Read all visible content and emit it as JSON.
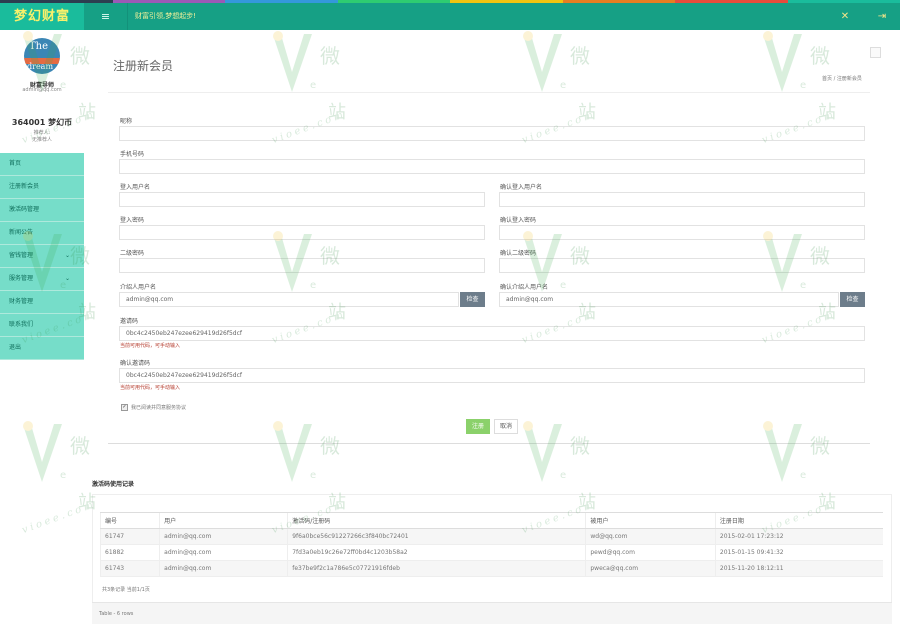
{
  "header": {
    "brand": "梦幻财富",
    "menu_icon": "≡",
    "menu_icon_name": "menu-icon",
    "marquee": "财富引领,梦想起步!",
    "tool_icon": "✕",
    "exit_icon": "⇥",
    "colors": {
      "bar": "#16a085",
      "brand_bg": "#1abc9c",
      "brand_text": "#f9f06b"
    },
    "rainbow": [
      "#2c3e50",
      "#9b59b6",
      "#3498db",
      "#2ecc71",
      "#f1c40f",
      "#e67e22",
      "#e74c3c",
      "#1abc9c"
    ]
  },
  "sidebar": {
    "avatar_text_top": "The",
    "avatar_text_bottom": "dream",
    "user_name": "财富导师",
    "user_email": "admin@qq.com",
    "balance": "364001 梦幻币",
    "referrer_label": "推荐人:",
    "referrer_value": "无推荐人",
    "nav": [
      {
        "label": "首页"
      },
      {
        "label": "注册新会员"
      },
      {
        "label": "激活码管理"
      },
      {
        "label": "新闻公告"
      },
      {
        "label": "留钱管理",
        "arrow": "⌄"
      },
      {
        "label": "服务管理",
        "arrow": "⌄"
      },
      {
        "label": "财务管理"
      },
      {
        "label": "联系我们"
      },
      {
        "label": "退出"
      }
    ]
  },
  "page": {
    "title": "注册新会员",
    "breadcrumb": "首页 / 注册新会员"
  },
  "form": {
    "nickname_label": "昵称",
    "nickname_value": "",
    "phone_label": "手机号码",
    "phone_value": "",
    "login_user_label": "登入用户名",
    "login_user_value": "",
    "confirm_login_user_label": "确认登入用户名",
    "confirm_login_user_value": "",
    "login_pwd_label": "登入密码",
    "login_pwd_value": "",
    "confirm_login_pwd_label": "确认登入密码",
    "confirm_login_pwd_value": "",
    "second_pwd_label": "二级密码",
    "second_pwd_value": "",
    "confirm_second_pwd_label": "确认二级密码",
    "confirm_second_pwd_value": "",
    "referrer_label": "介绍人用户名",
    "referrer_value": "admin@qq.com",
    "referrer_btn": "检查",
    "confirm_referrer_label": "确认介绍人用户名",
    "confirm_referrer_value": "admin@qq.com",
    "confirm_referrer_btn": "检查",
    "invite_label": "邀请码",
    "invite_value": "0bc4c2450eb247ezee629419d26f5dcf",
    "invite_hint": "当前可用代码，可手动输入",
    "confirm_invite_label": "确认邀请码",
    "confirm_invite_value": "0bc4c2450eb247ezee629419d26f5dcf",
    "confirm_invite_hint": "当前可用代码，可手动输入",
    "agree_checked": "✓",
    "agree_label": "我已阅读并同意服务协议",
    "submit_btn": "注册",
    "cancel_btn": "取消"
  },
  "records": {
    "title": "激活码使用记录",
    "columns": [
      "编号",
      "用户",
      "激活码/注册码",
      "被用户",
      "注册日期"
    ],
    "rows": [
      [
        "61747",
        "admin@qq.com",
        "9f6a0bce56c91227266c3f840bc72401",
        "wd@qq.com",
        "2015-02-01 17:23:12"
      ],
      [
        "61882",
        "admin@qq.com",
        "7fd3a0eb19c26e72ff0bd4c1203b58a2",
        "pewd@qq.com",
        "2015-01-15 09:41:32"
      ],
      [
        "61743",
        "admin@qq.com",
        "fe37be9f2c1a786e5c07721916fdeb",
        "pweca@qq.com",
        "2015-11-20 18:12:11"
      ]
    ],
    "pager": "共3条记录 当前1/1页",
    "footer": "Table - 6 rows"
  },
  "watermark": {
    "char_wei": "微",
    "char_zhan": "站",
    "char_e": "e",
    "url": "vioee.com"
  }
}
